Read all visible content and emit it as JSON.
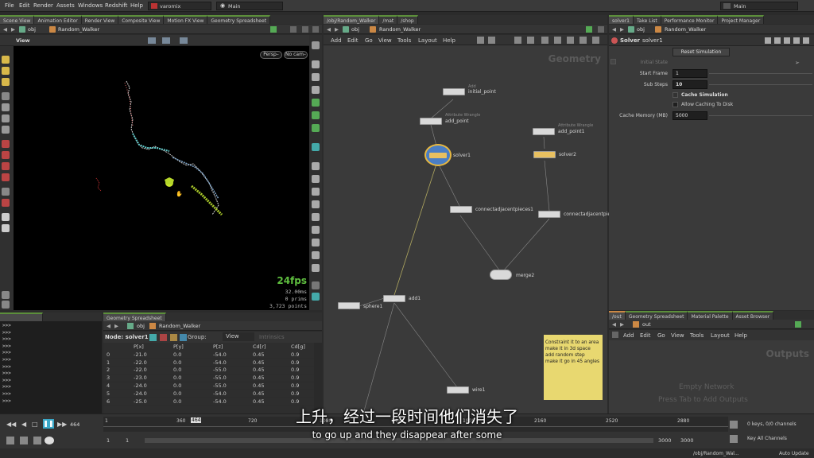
{
  "menu": [
    "File",
    "Edit",
    "Render",
    "Assets",
    "Windows",
    "Redshift",
    "Help"
  ],
  "desktop": "varomix",
  "main_desktop": "Main",
  "main_desktop_right": "Main",
  "left_tabs": [
    "Scene View",
    "Animation Editor",
    "Render View",
    "Composite View",
    "Motion FX View",
    "Geometry Spreadsheet"
  ],
  "mid_tabs": [
    "/obj/Random_Walker",
    "/mat",
    "/shop"
  ],
  "right_tabs": [
    "solver1",
    "Take List",
    "Performance Monitor",
    "Project Manager"
  ],
  "viewport": {
    "path_obj": "obj",
    "path_node": "Random_Walker",
    "title": "View",
    "persp": "Persp–",
    "cam": "No cam–",
    "fps": "24fps",
    "ms": "32.00ms",
    "prims_val": "0",
    "prims_label": "prims",
    "points_val": "3,723",
    "points_label": "points"
  },
  "network": {
    "path_obj": "obj",
    "path_node": "Random_Walker",
    "menu": [
      "Add",
      "Edit",
      "Go",
      "View",
      "Tools",
      "Layout",
      "Help"
    ],
    "context_label": "Geometry",
    "nodes": [
      {
        "name": "initial_point",
        "type": "Add"
      },
      {
        "name": "add_point",
        "type": "Attribute Wrangle"
      },
      {
        "name": "add_point1",
        "type": "Attribute Wrangle"
      },
      {
        "name": "solver1",
        "type": ""
      },
      {
        "name": "solver2",
        "type": ""
      },
      {
        "name": "connectadjacentpieces1",
        "type": ""
      },
      {
        "name": "connectadjacentpie",
        "type": ""
      },
      {
        "name": "merge2",
        "type": ""
      },
      {
        "name": "add1",
        "type": ""
      },
      {
        "name": "sphere1",
        "type": ""
      },
      {
        "name": "wire1",
        "type": ""
      }
    ],
    "sticky_note": [
      "Constraint it to an area",
      "make it in 3d space",
      "add random step",
      "make it go in 45 angles"
    ]
  },
  "params": {
    "node_type": "Solver",
    "node_name": "solver1",
    "reset_button": "Reset Simulation",
    "initial_state_label": "Initial State",
    "start_frame_label": "Start Frame",
    "start_frame": "1",
    "sub_steps_label": "Sub Steps",
    "sub_steps": "10",
    "cache_sim": "Cache Simulation",
    "allow_caching": "Allow Caching To Disk",
    "cache_mem_label": "Cache Memory (MB)",
    "cache_mem": "5000"
  },
  "console_lines": [
    ">>>",
    ">>>",
    ">>>",
    ">>>",
    ">>>",
    ">>>",
    ">>>",
    ">>>",
    ">>>",
    ">>>",
    ">>>",
    ">>>"
  ],
  "spreadsheet": {
    "tab": "Geometry Spreadsheet",
    "path_obj": "obj",
    "path_node": "Random_Walker",
    "node_label": "Node: solver1",
    "group_label": "Group:",
    "view_label": "View",
    "intrinsics_label": "Intrinsics",
    "columns": [
      "",
      "P[x]",
      "P[y]",
      "P[z]",
      "Cd[r]",
      "Cd[g]"
    ],
    "rows": [
      [
        "0",
        "-21.0",
        "0.0",
        "-54.0",
        "0.45",
        "0.9"
      ],
      [
        "1",
        "-22.0",
        "0.0",
        "-54.0",
        "0.45",
        "0.9"
      ],
      [
        "2",
        "-22.0",
        "0.0",
        "-55.0",
        "0.45",
        "0.9"
      ],
      [
        "3",
        "-23.0",
        "0.0",
        "-55.0",
        "0.45",
        "0.9"
      ],
      [
        "4",
        "-24.0",
        "0.0",
        "-55.0",
        "0.45",
        "0.9"
      ],
      [
        "5",
        "-24.0",
        "0.0",
        "-54.0",
        "0.45",
        "0.9"
      ],
      [
        "6",
        "-25.0",
        "0.0",
        "-54.0",
        "0.45",
        "0.9"
      ]
    ]
  },
  "outputs": {
    "tabs": [
      "/out",
      "Geometry Spreadsheet",
      "Material Palette",
      "Asset Browser"
    ],
    "path": "out",
    "menu": [
      "Add",
      "Edit",
      "Go",
      "View",
      "Tools",
      "Layout",
      "Help"
    ],
    "title": "Outputs",
    "empty1": "Empty Network",
    "empty2": "Press Tab to Add Outputs"
  },
  "timeline": {
    "current_frame": "464",
    "frame_indicator": "464",
    "ticks": [
      "1",
      "360",
      "720",
      "1080",
      "1440",
      "1800",
      "2160",
      "2520",
      "2880"
    ],
    "start": "1",
    "start2": "1",
    "end": "3000",
    "end2": "3000",
    "keys_info": "0 keys, 0/0 channels",
    "key_all": "Key All Channels",
    "status_path": "/obj/Random_Wal...",
    "auto_update": "Auto Update"
  },
  "subtitle_cn": "上升，经过一段时间他们消失了",
  "subtitle_en": "to go up and they disappear after some"
}
